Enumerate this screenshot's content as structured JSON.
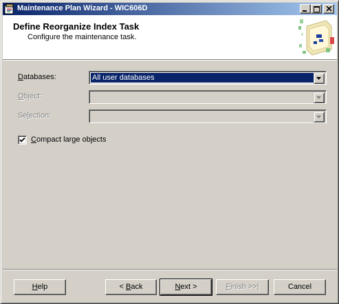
{
  "window": {
    "title": "Maintenance Plan Wizard - WIC606D",
    "title_icon": "wizard-app-icon",
    "controls": [
      "minimize",
      "maximize",
      "close"
    ]
  },
  "header": {
    "title": "Define Reorganize Index Task",
    "subtitle": "Configure the maintenance task.",
    "art": "wizard-banner-graphic"
  },
  "form": {
    "databases": {
      "label_pre": "",
      "label_acc": "D",
      "label_post": "atabases:",
      "value": "All user databases",
      "enabled": true
    },
    "object": {
      "label_pre": "",
      "label_acc": "O",
      "label_post": "bject:",
      "value": "",
      "enabled": false
    },
    "selection": {
      "label_pre": "Se",
      "label_acc": "l",
      "label_post": "ection:",
      "value": "",
      "enabled": false
    },
    "compact": {
      "label_pre": "",
      "label_acc": "C",
      "label_post": "ompact large objects",
      "checked": true
    }
  },
  "buttons": {
    "help": {
      "pre": "",
      "acc": "H",
      "post": "elp"
    },
    "back": {
      "pre": "< ",
      "acc": "B",
      "post": "ack"
    },
    "next": {
      "pre": "",
      "acc": "N",
      "post": "ext >"
    },
    "finish": {
      "pre": "",
      "acc": "F",
      "post": "inish >>|"
    },
    "cancel": {
      "pre": "Cancel",
      "acc": "",
      "post": ""
    }
  },
  "colors": {
    "titlebar_start": "#0a246a",
    "titlebar_end": "#a6caf0",
    "face": "#d4d0c8",
    "selection": "#0a246a"
  }
}
